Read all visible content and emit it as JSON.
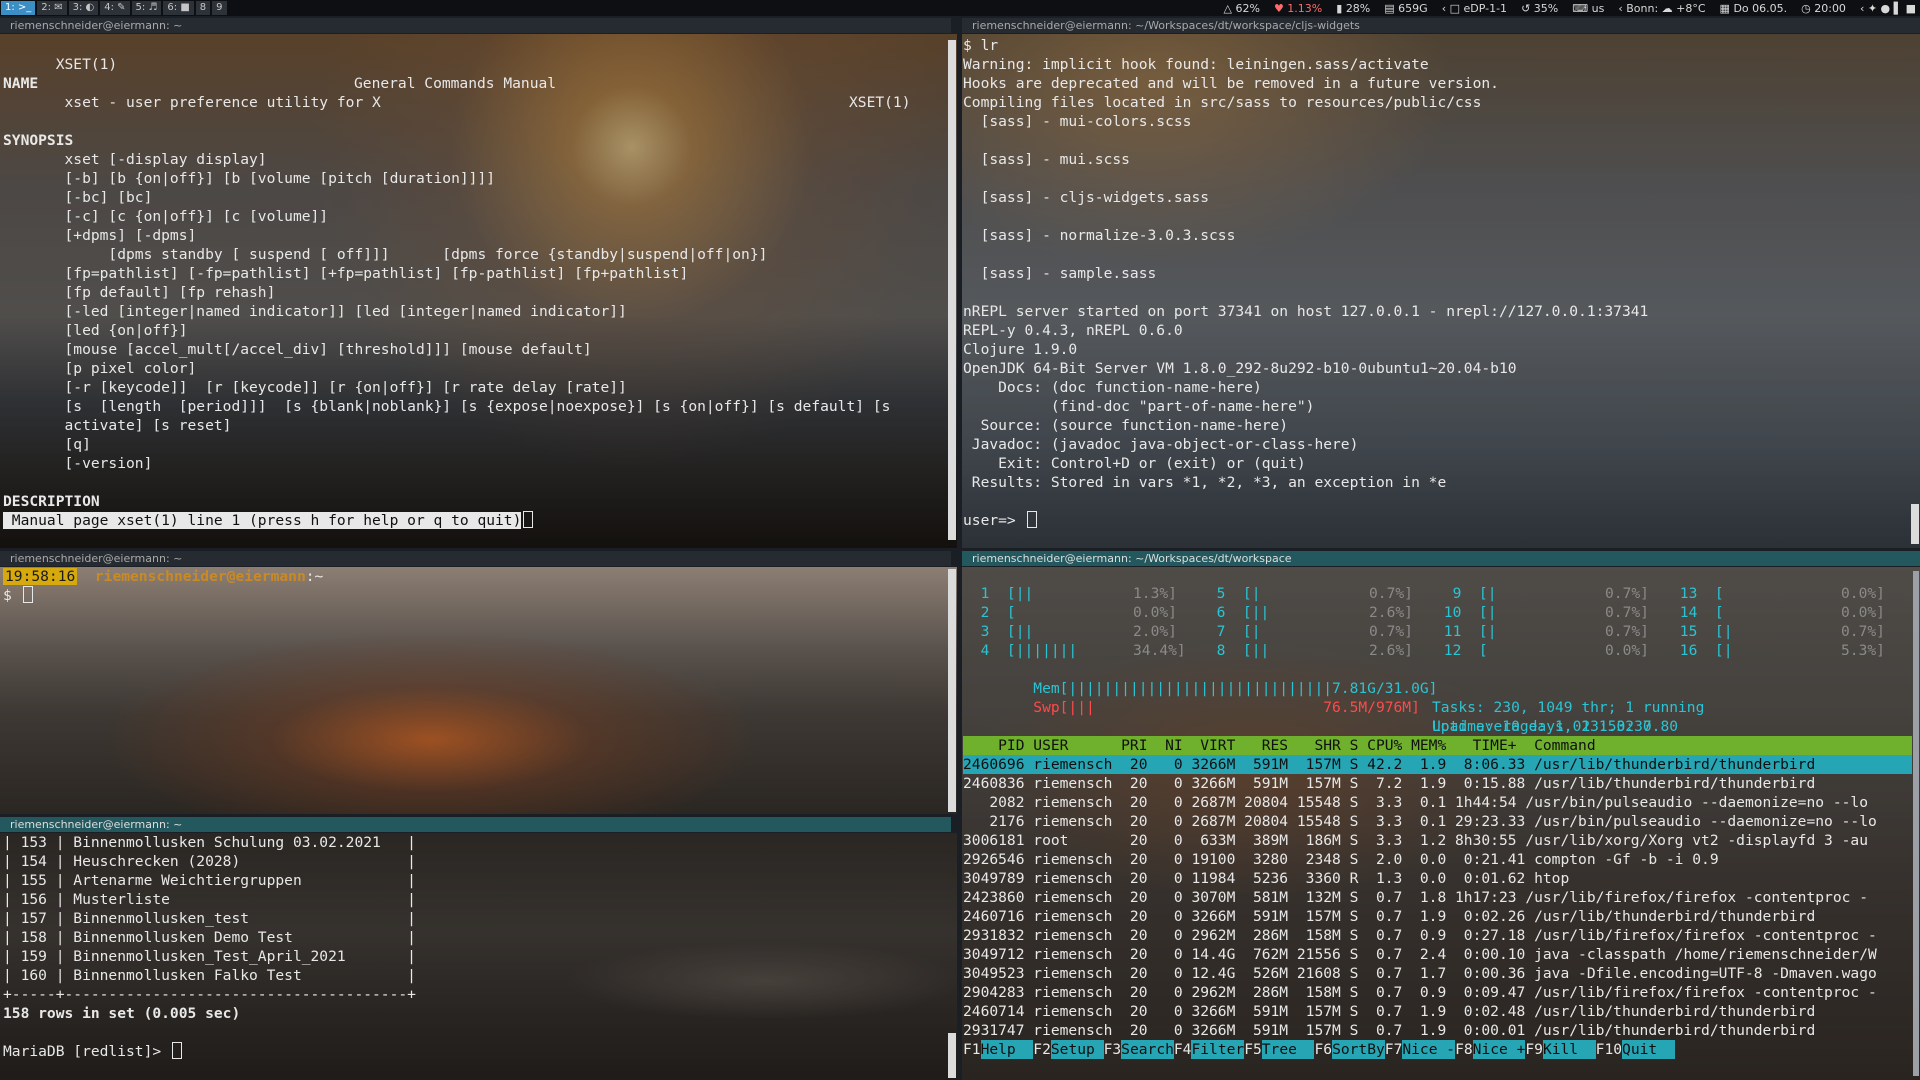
{
  "topbar": {
    "workspaces": [
      "1: >_",
      "2: ✉",
      "3: ◐",
      "4: ✎",
      "5: ♬",
      "6: ■",
      "8",
      "9"
    ],
    "status": {
      "wifi": "62%",
      "heart": "1.13%",
      "battery": "28%",
      "disk": "659G",
      "display": "eDP-1-1",
      "volume": "35%",
      "keyboard": "us",
      "weather": "Bonn: ☁ +8°C",
      "date": "Do 06.05.",
      "time": "20:00"
    }
  },
  "man_pane": {
    "title": "riemenschneider@eiermann: ~",
    "header_left": "XSET(1)",
    "header_center": "General Commands Manual",
    "header_right": "XSET(1)",
    "name_heading": "NAME",
    "name_line": "       xset - user preference utility for X",
    "synopsis_heading": "SYNOPSIS",
    "synopsis": [
      "       xset [-display display]",
      "       [-b] [b {on|off}] [b [volume [pitch [duration]]]]",
      "       [-bc] [bc]",
      "       [-c] [c {on|off}] [c [volume]]",
      "       [+dpms] [-dpms]",
      "            [dpms standby [ suspend [ off]]]      [dpms force {standby|suspend|off|on}]",
      "       [fp=pathlist] [-fp=pathlist] [+fp=pathlist] [fp-pathlist] [fp+pathlist]",
      "       [fp default] [fp rehash]",
      "       [-led [integer|named indicator]] [led [integer|named indicator]]",
      "       [led {on|off}]",
      "       [mouse [accel_mult[/accel_div] [threshold]]] [mouse default]",
      "       [p pixel color]",
      "       [-r [keycode]]  [r [keycode]] [r {on|off}] [r rate delay [rate]]",
      "       [s  [length  [period]]]  [s {blank|noblank}] [s {expose|noexpose}] [s {on|off}] [s default] [s",
      "       activate] [s reset]",
      "       [q]",
      "       [-version]"
    ],
    "description_heading": "DESCRIPTION",
    "status_line": " Manual page xset(1) line 1 (press h for help or q to quit)"
  },
  "repl_pane": {
    "title": "riemenschneider@eiermann: ~/Workspaces/dt/workspace/cljs-widgets",
    "lines": [
      "$ lr",
      "Warning: implicit hook found: leiningen.sass/activate",
      "Hooks are deprecated and will be removed in a future version.",
      "Compiling files located in src/sass to resources/public/css",
      "  [sass] - mui-colors.scss",
      "",
      "  [sass] - mui.scss",
      "",
      "  [sass] - cljs-widgets.sass",
      "",
      "  [sass] - normalize-3.0.3.scss",
      "",
      "  [sass] - sample.sass",
      "",
      "nREPL server started on port 37341 on host 127.0.0.1 - nrepl://127.0.0.1:37341",
      "REPL-y 0.4.3, nREPL 0.6.0",
      "Clojure 1.9.0",
      "OpenJDK 64-Bit Server VM 1.8.0_292-8u292-b10-0ubuntu1~20.04-b10",
      "    Docs: (doc function-name-here)",
      "          (find-doc \"part-of-name-here\")",
      "  Source: (source function-name-here)",
      " Javadoc: (javadoc java-object-or-class-here)",
      "    Exit: Control+D or (exit) or (quit)",
      " Results: Stored in vars *1, *2, *3, an exception in *e",
      ""
    ],
    "prompt": "user=> "
  },
  "shell_pane": {
    "title": "riemenschneider@eiermann: ~",
    "clock": "19:58:16",
    "userhost": "riemenschneider@eiermann",
    "path": ":~",
    "prompt": "$ "
  },
  "sql_pane": {
    "title": "riemenschneider@eiermann: ~",
    "rows": [
      "| 153 | Binnenmollusken Schulung 03.02.2021   |",
      "| 154 | Heuschrecken (2028)                   |",
      "| 155 | Artenarme Weichtiergruppen            |",
      "| 156 | Musterliste                           |",
      "| 157 | Binnenmollusken_test                  |",
      "| 158 | Binnenmollusken Demo Test             |",
      "| 159 | Binnenmollusken_Test_April_2021       |",
      "| 160 | Binnenmollusken Falko Test            |",
      "+-----+---------------------------------------+"
    ],
    "summary": "158 rows in set (0.005 sec)",
    "prompt": "MariaDB [redlist]> "
  },
  "htop_pane": {
    "title": "riemenschneider@eiermann: ~/Workspaces/dt/workspace",
    "cpus": [
      [
        "  1  [||",
        "1.3%]",
        "  5  [|",
        "0.7%]",
        "  9  [|",
        "0.7%]",
        " 13  [",
        "0.0%]"
      ],
      [
        "  2  [",
        "0.0%]",
        "  6  [||",
        "2.6%]",
        " 10  [|",
        "0.7%]",
        " 14  [",
        "0.0%]"
      ],
      [
        "  3  [||",
        "2.0%]",
        "  7  [|",
        "0.7%]",
        " 11  [|",
        "0.7%]",
        " 15  [|",
        "0.7%]"
      ],
      [
        "  4  [|||||||",
        "34.4%]",
        "  8  [||",
        "2.6%]",
        " 12  [",
        "0.0%]",
        " 16  [|",
        "5.3%]"
      ]
    ],
    "mem": "  Mem[||||||||||||||||||||||||||||||7.81G/31.0G]",
    "swp": "  Swp[|||                          76.5M/976M]",
    "tasks": "Tasks: 230, 1049 thr; 1 running",
    "load": "Load average: 1.01 1.02 0.80",
    "uptime": "Uptime: 10 days, 23:53:37",
    "header": "    PID USER      PRI  NI  VIRT   RES   SHR S CPU% MEM%   TIME+  Command",
    "processes": [
      "2460696 riemensch  20   0 3266M  591M  157M S 42.2  1.9  8:06.33 /usr/lib/thunderbird/thunderbird",
      "2460836 riemensch  20   0 3266M  591M  157M S  7.2  1.9  0:15.88 /usr/lib/thunderbird/thunderbird",
      "   2082 riemensch  20   0 2687M 20804 15548 S  3.3  0.1 1h44:54 /usr/bin/pulseaudio --daemonize=no --lo",
      "   2176 riemensch  20   0 2687M 20804 15548 S  3.3  0.1 29:23.33 /usr/bin/pulseaudio --daemonize=no --lo",
      "3006181 root       20   0  633M  389M  186M S  3.3  1.2 8h30:55 /usr/lib/xorg/Xorg vt2 -displayfd 3 -au",
      "2926546 riemensch  20   0 19100  3280  2348 S  2.0  0.0  0:21.41 compton -Gf -b -i 0.9",
      "3049789 riemensch  20   0 11984  5236  3360 R  1.3  0.0  0:01.62 htop",
      "2423860 riemensch  20   0 3070M  581M  132M S  0.7  1.8 1h17:23 /usr/lib/firefox/firefox -contentproc -",
      "2460716 riemensch  20   0 3266M  591M  157M S  0.7  1.9  0:02.26 /usr/lib/thunderbird/thunderbird",
      "2931832 riemensch  20   0 2962M  286M  158M S  0.7  0.9  0:27.18 /usr/lib/firefox/firefox -contentproc -",
      "3049712 riemensch  20   0 14.4G  762M 21556 S  0.7  2.4  0:00.10 java -classpath /home/riemenschneider/W",
      "3049523 riemensch  20   0 12.4G  526M 21608 S  0.7  1.7  0:00.36 java -Dfile.encoding=UTF-8 -Dmaven.wago",
      "2904283 riemensch  20   0 2962M  286M  158M S  0.7  0.9  0:09.47 /usr/lib/firefox/firefox -contentproc -",
      "2460714 riemensch  20   0 3266M  591M  157M S  0.7  1.9  0:02.48 /usr/lib/thunderbird/thunderbird",
      "2931747 riemensch  20   0 3266M  591M  157M S  0.7  1.9  0:00.01 /usr/lib/thunderbird/thunderbird"
    ],
    "fkeys": [
      [
        "F1",
        "Help  "
      ],
      [
        "F2",
        "Setup "
      ],
      [
        "F3",
        "Search"
      ],
      [
        "F4",
        "Filter"
      ],
      [
        "F5",
        "Tree  "
      ],
      [
        "F6",
        "SortBy"
      ],
      [
        "F7",
        "Nice -"
      ],
      [
        "F8",
        "Nice +"
      ],
      [
        "F9",
        "Kill  "
      ],
      [
        "F10",
        "Quit  "
      ]
    ]
  }
}
